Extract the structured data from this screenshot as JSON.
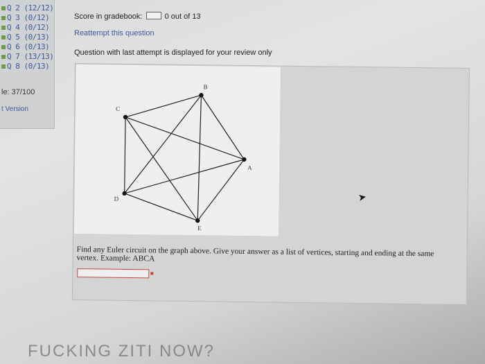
{
  "sidebar": {
    "questions": [
      {
        "label": "Q 2 (12/12)"
      },
      {
        "label": "Q 3 (0/12)"
      },
      {
        "label": "Q 4 (0/12)"
      },
      {
        "label": "Q 5 (0/13)"
      },
      {
        "label": "Q 6 (0/13)"
      },
      {
        "label": "Q 7 (13/13)"
      },
      {
        "label": "Q 8 (0/13)"
      }
    ],
    "score": "le: 37/100",
    "version": "t Version"
  },
  "header": {
    "score_label": "Score in gradebook:",
    "score_value": "0 out of 13",
    "reattempt": "Reattempt this question",
    "review_note": "Question with last attempt is displayed for your review only"
  },
  "graph": {
    "vertices": [
      {
        "id": "B",
        "label": "B"
      },
      {
        "id": "C",
        "label": "C"
      },
      {
        "id": "A",
        "label": "A"
      },
      {
        "id": "D",
        "label": "D"
      },
      {
        "id": "E",
        "label": "E"
      }
    ]
  },
  "question": {
    "text": "Find any Euler circuit on the graph above. Give your answer as a list of vertices, starting and ending at the same vertex. Example: ABCA",
    "answer_value": ""
  },
  "overlay": {
    "caption": "FUCKING ZITI NOW?"
  }
}
